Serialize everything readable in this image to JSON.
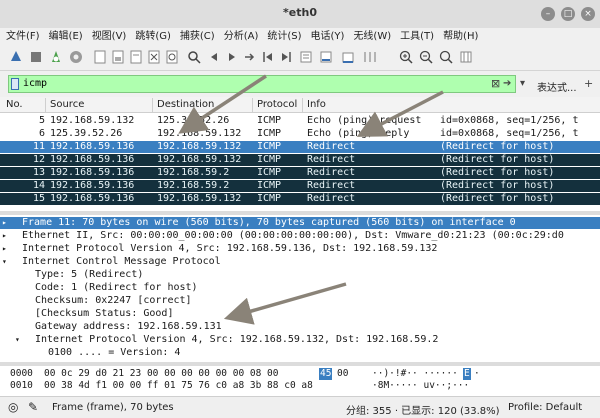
{
  "window": {
    "title": "*eth0",
    "minimize_glyph": "–",
    "maximize_glyph": "□",
    "close_glyph": "×"
  },
  "menu": [
    "文件(F)",
    "编辑(E)",
    "视图(V)",
    "跳转(G)",
    "捕获(C)",
    "分析(A)",
    "统计(S)",
    "电话(Y)",
    "无线(W)",
    "工具(T)",
    "帮助(H)"
  ],
  "filter": {
    "value": "icmp",
    "expression_label": "表达式...",
    "plus": "+"
  },
  "packet_list": {
    "columns": [
      "No.",
      "Source",
      "Destination",
      "Protocol",
      "Info"
    ],
    "rows": [
      {
        "no": "5",
        "source": "192.168.59.132",
        "destination": "125.39.52.26",
        "protocol": "ICMP",
        "info": "Echo (ping) request",
        "extra": "id=0x0868, seq=1/256, t",
        "style": "echo"
      },
      {
        "no": "6",
        "source": "125.39.52.26",
        "destination": "192.168.59.132",
        "protocol": "ICMP",
        "info": "Echo (ping) reply",
        "extra": "id=0x0868, seq=1/256, t",
        "style": "echo"
      },
      {
        "no": "11",
        "source": "192.168.59.136",
        "destination": "192.168.59.132",
        "protocol": "ICMP",
        "info": "Redirect",
        "extra": "(Redirect for host)",
        "style": "selected"
      },
      {
        "no": "12",
        "source": "192.168.59.136",
        "destination": "192.168.59.132",
        "protocol": "ICMP",
        "info": "Redirect",
        "extra": "(Redirect for host)",
        "style": "redirect"
      },
      {
        "no": "13",
        "source": "192.168.59.136",
        "destination": "192.168.59.2",
        "protocol": "ICMP",
        "info": "Redirect",
        "extra": "(Redirect for host)",
        "style": "redirect"
      },
      {
        "no": "14",
        "source": "192.168.59.136",
        "destination": "192.168.59.2",
        "protocol": "ICMP",
        "info": "Redirect",
        "extra": "(Redirect for host)",
        "style": "redirect"
      },
      {
        "no": "15",
        "source": "192.168.59.136",
        "destination": "192.168.59.132",
        "protocol": "ICMP",
        "info": "Redirect",
        "extra": "(Redirect for host)",
        "style": "redirect"
      }
    ]
  },
  "details": [
    {
      "text": "Frame 11: 70 bytes on wire (560 bits), 70 bytes captured (560 bits) on interface 0",
      "indent": 0,
      "arrow": "▸",
      "selected": true
    },
    {
      "text": "Ethernet II, Src: 00:00:00_00:00:00 (00:00:00:00:00:00), Dst: Vmware_d0:21:23 (00:0c:29:d0",
      "indent": 0,
      "arrow": "▸",
      "selected": false
    },
    {
      "text": "Internet Protocol Version 4, Src: 192.168.59.136, Dst: 192.168.59.132",
      "indent": 0,
      "arrow": "▸",
      "selected": false
    },
    {
      "text": "Internet Control Message Protocol",
      "indent": 0,
      "arrow": "▾",
      "selected": false
    },
    {
      "text": "Type: 5 (Redirect)",
      "indent": 1,
      "arrow": "",
      "selected": false
    },
    {
      "text": "Code: 1 (Redirect for host)",
      "indent": 1,
      "arrow": "",
      "selected": false
    },
    {
      "text": "Checksum: 0x2247 [correct]",
      "indent": 1,
      "arrow": "",
      "selected": false
    },
    {
      "text": "[Checksum Status: Good]",
      "indent": 1,
      "arrow": "",
      "selected": false
    },
    {
      "text": "Gateway address: 192.168.59.131",
      "indent": 1,
      "arrow": "",
      "selected": false
    },
    {
      "text": "Internet Protocol Version 4, Src: 192.168.59.132, Dst: 192.168.59.2",
      "indent": 1,
      "arrow": "▾",
      "selected": false
    },
    {
      "text": "0100 .... = Version: 4",
      "indent": 2,
      "arrow": "",
      "selected": false
    }
  ],
  "bytes": [
    {
      "offset": "0000",
      "hex_before": "00 0c 29 d0 21 23 00 00  00 00 00 00 08 00",
      "hex_highlight": "45",
      "hex_after": "00",
      "ascii_before": "  ··)·!#·· ······",
      "ascii_highlight": "E",
      "ascii_after": "·"
    },
    {
      "offset": "0010",
      "hex_before": "00 38 4d f1 00 00 ff 01  75 76 c0 a8 3b 88 c0 a8",
      "hex_highlight": "",
      "hex_after": "",
      "ascii_before": "·8M·····  uv··;···",
      "ascii_highlight": "",
      "ascii_after": ""
    }
  ],
  "status": {
    "frame_info": "Frame (frame), 70 bytes",
    "packet_stats": "分组: 355 · 已显示: 120 (33.8%)",
    "profile": "Profile: Default"
  }
}
